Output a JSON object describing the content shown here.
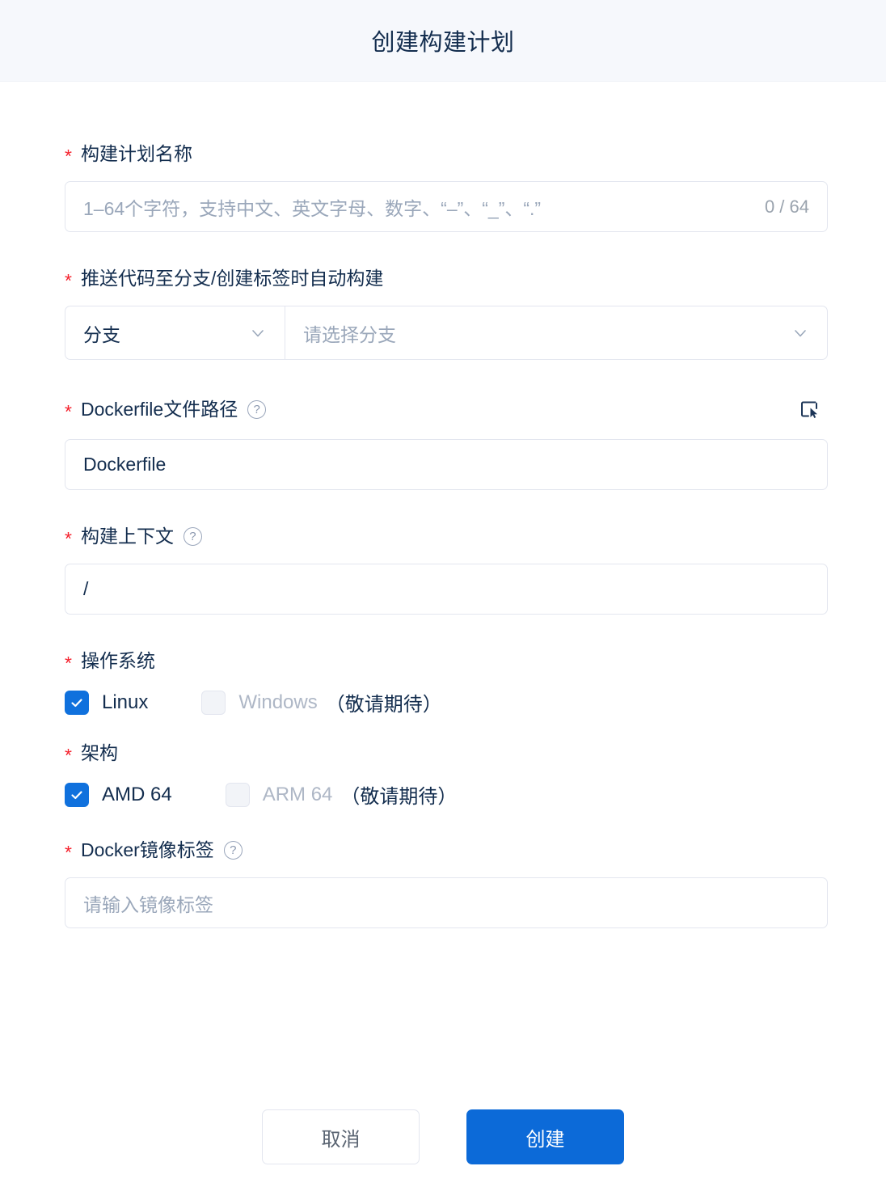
{
  "dialog": {
    "title": "创建构建计划"
  },
  "fields": {
    "plan_name": {
      "label": "构建计划名称",
      "required_mark": "*",
      "placeholder": "1–64个字符，支持中文、英文字母、数字、“–”、“_”、“.”",
      "value": "",
      "counter": "0 / 64"
    },
    "auto_build": {
      "label": "推送代码至分支/创建标签时自动构建",
      "required_mark": "*",
      "type_value": "分支",
      "branch_placeholder": "请选择分支",
      "type_icon": "chevron-down-icon",
      "branch_icon": "chevron-down-icon"
    },
    "dockerfile_path": {
      "label": "Dockerfile文件路径",
      "required_mark": "*",
      "help_icon": "question-circle-icon",
      "picker_icon": "file-select-icon",
      "value": "Dockerfile",
      "placeholder": ""
    },
    "build_context": {
      "label": "构建上下文",
      "required_mark": "*",
      "help_icon": "question-circle-icon",
      "value": "/",
      "placeholder": ""
    },
    "operating_system": {
      "label": "操作系统",
      "required_mark": "*",
      "options": [
        {
          "label": "Linux",
          "checked": true,
          "disabled": false
        },
        {
          "label": "Windows",
          "checked": false,
          "disabled": true
        }
      ],
      "note": "（敬请期待）"
    },
    "architecture": {
      "label": "架构",
      "required_mark": "*",
      "options": [
        {
          "label": "AMD 64",
          "checked": true,
          "disabled": false
        },
        {
          "label": "ARM 64",
          "checked": false,
          "disabled": true
        }
      ],
      "note": "（敬请期待）"
    },
    "image_tag": {
      "label": "Docker镜像标签",
      "required_mark": "*",
      "help_icon": "question-circle-icon",
      "placeholder": "请输入镜像标签",
      "value": ""
    }
  },
  "footer": {
    "cancel_label": "取消",
    "submit_label": "创建"
  },
  "colors": {
    "header_bg": "#f6f8fc",
    "title_text": "#132d4e",
    "required_star": "#f5222d",
    "primary": "#0c6ad8",
    "checkbox_checked": "#1071dd",
    "border": "#e3e6ef",
    "placeholder": "#9aa7ba"
  }
}
